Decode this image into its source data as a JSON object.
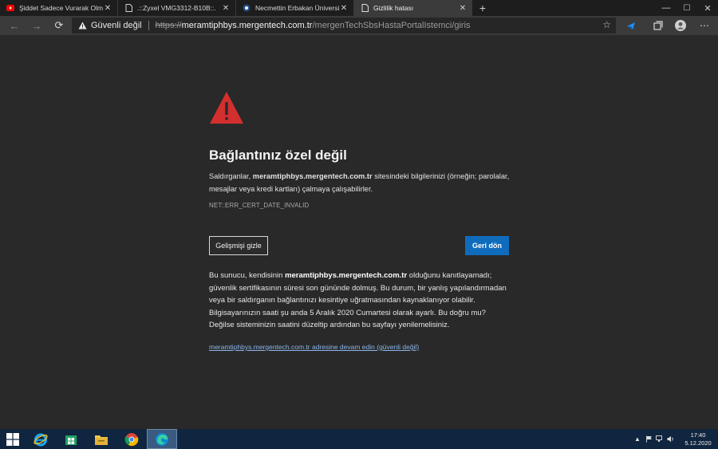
{
  "tabs": [
    {
      "title": "Şiddet Sadece Vurarak Olmaz! | Y",
      "icon": "youtube-icon",
      "active": false
    },
    {
      "title": ".::Zyxel VMG3312-B10B::.",
      "icon": "page-icon",
      "active": false
    },
    {
      "title": "Necmettin Erbakan Üniversitesi H",
      "icon": "university-icon",
      "active": false
    },
    {
      "title": "Gizlilik hatası",
      "icon": "page-icon",
      "active": true
    }
  ],
  "address_bar": {
    "security_label": "Güvenli değil",
    "scheme": "https://",
    "host": "meramtiphbys.mergentech.com.tr",
    "path": "/mergenTechSbsHastaPortalIstemci/giris"
  },
  "error": {
    "title": "Bağlantınız özel değil",
    "desc_pre": "Saldırganlar, ",
    "desc_host": "meramtiphbys.mergentech.com.tr",
    "desc_post": " sitesindeki bilgilerinizi (örneğin; parolalar, mesajlar veya kredi kartları) çalmaya çalışabilirler.",
    "code": "NET::ERR_CERT_DATE_INVALID",
    "advanced_button": "Gelişmişi gizle",
    "back_button": "Geri dön",
    "details_pre": "Bu sunucu, kendisinin ",
    "details_host": "meramtiphbys.mergentech.com.tr",
    "details_post": " olduğunu kanıtlayamadı; güvenlik sertifikasının süresi son gününde dolmuş. Bu durum, bir yanlış yapılandırmadan veya bir saldırganın bağlantınızı kesintiye uğratmasından kaynaklanıyor olabilir. Bilgisayarınızın saati şu anda 5 Aralık 2020 Cumartesi olarak ayarlı. Bu doğru mu? Değilse sisteminizin saatini düzeltip ardından bu sayfayı yenilemelisiniz.",
    "proceed_link": "meramtiphbys.mergentech.com.tr adresine devam edin (güvenli değil)"
  },
  "taskbar": {
    "time": "17:40",
    "date": "5.12.2020"
  },
  "colors": {
    "accent": "#0f6cbd",
    "warning": "#d32f2f"
  }
}
